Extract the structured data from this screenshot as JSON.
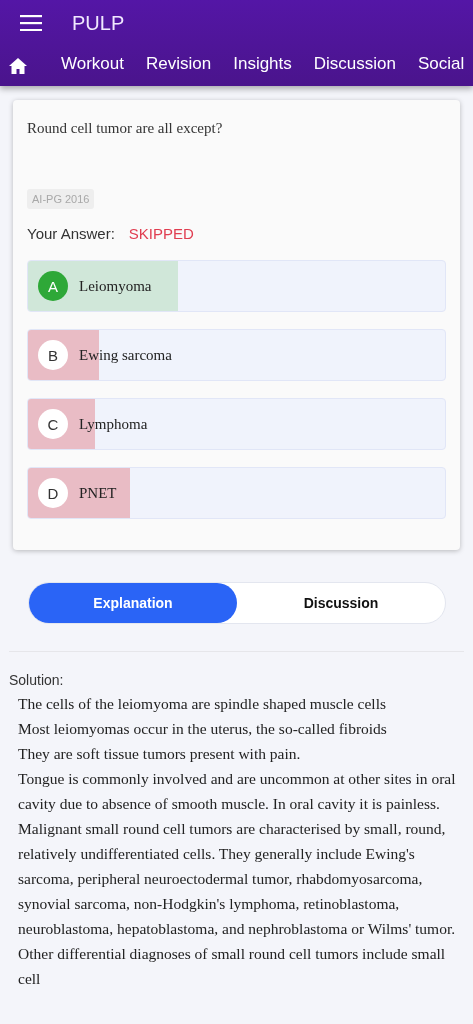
{
  "app_bar": {
    "title": "PULP"
  },
  "tabs": [
    {
      "label": "Workout",
      "selected": false
    },
    {
      "label": "Revision",
      "selected": false
    },
    {
      "label": "Insights",
      "selected": false
    },
    {
      "label": "Discussion",
      "selected": false
    },
    {
      "label": "Social",
      "selected": false
    }
  ],
  "question": {
    "text": "Round cell tumor are all except?",
    "tag": "AI-PG 2016",
    "answer_label": "Your Answer:",
    "answer_value": "SKIPPED"
  },
  "options": [
    {
      "letter": "A",
      "text": "Leiomyoma",
      "correct": true,
      "level": 0.36
    },
    {
      "letter": "B",
      "text": "Ewing sarcoma",
      "correct": false,
      "level": 0.17
    },
    {
      "letter": "C",
      "text": "Lymphoma",
      "correct": false,
      "level": 0.16
    },
    {
      "letter": "D",
      "text": "PNET",
      "correct": false,
      "level": 0.245
    }
  ],
  "segments": [
    {
      "label": "Explanation",
      "selected": true
    },
    {
      "label": "Discussion",
      "selected": false
    }
  ],
  "solution": {
    "heading": "Solution:",
    "paragraphs": [
      "The cells of the leiomyoma are spindle shaped muscle cells",
      "Most leiomyomas occur in the uterus, the so-called fibroids",
      "They are soft tissue tumors present with pain.",
      "Tongue is commonly involved and are uncommon at other sites in oral cavity due to absence of smooth muscle. In oral cavity it is painless.",
      "Malignant small round cell tumors are characterised by small, round, relatively undifferentiated cells. They generally include Ewing's sarcoma, peripheral neuroectodermal tumor, rhabdomyosarcoma, synovial sarcoma, non-Hodgkin's lymphoma, retinoblastoma, neuroblastoma, hepatoblastoma, and nephroblastoma or Wilms' tumor. Other differential diagnoses of small round cell tumors include small cell"
    ]
  }
}
